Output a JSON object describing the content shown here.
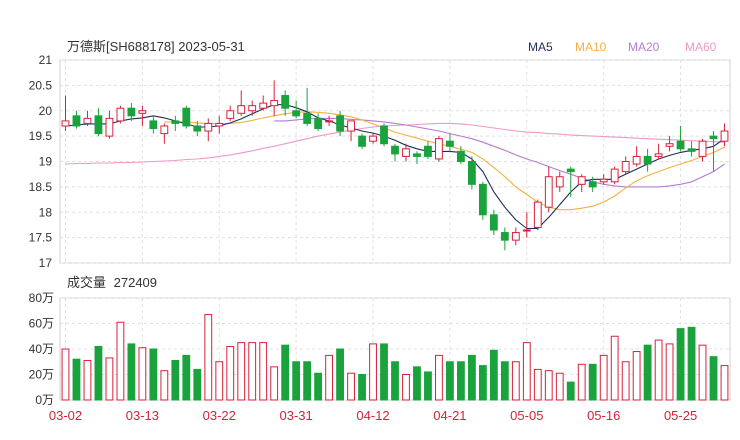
{
  "header": {
    "title": "万德斯[SH688178] 2023-05-31"
  },
  "legend": [
    {
      "label": "MA5",
      "color": "#1f2d5a"
    },
    {
      "label": "MA10",
      "color": "#f5b042"
    },
    {
      "label": "MA20",
      "color": "#b57cd6"
    },
    {
      "label": "MA60",
      "color": "#f098c8"
    }
  ],
  "colors": {
    "up": "#d8213a",
    "down": "#1aa33c"
  },
  "volume_title": {
    "label": "成交量",
    "value": "272409"
  },
  "chart_data": [
    {
      "type": "candlestick",
      "price_axis": {
        "ylim": [
          17,
          21
        ],
        "ticks": [
          "21",
          "20.5",
          "20",
          "19.5",
          "19",
          "18.5",
          "18",
          "17.5",
          "17"
        ]
      },
      "dates": [
        "03-02",
        "03-03",
        "03-06",
        "03-07",
        "03-08",
        "03-09",
        "03-10",
        "03-13",
        "03-14",
        "03-15",
        "03-16",
        "03-17",
        "03-20",
        "03-21",
        "03-22",
        "03-23",
        "03-24",
        "03-27",
        "03-28",
        "03-29",
        "03-30",
        "03-31",
        "04-03",
        "04-04",
        "04-06",
        "04-07",
        "04-10",
        "04-11",
        "04-12",
        "04-13",
        "04-14",
        "04-17",
        "04-18",
        "04-19",
        "04-20",
        "04-21",
        "04-24",
        "04-25",
        "04-26",
        "04-27",
        "04-28",
        "05-04",
        "05-05",
        "05-08",
        "05-09",
        "05-10",
        "05-11",
        "05-12",
        "05-15",
        "05-16",
        "05-17",
        "05-18",
        "05-19",
        "05-22",
        "05-23",
        "05-24",
        "05-25",
        "05-26",
        "05-29",
        "05-30",
        "05-31"
      ],
      "x_tick_labels": [
        "03-02",
        "03-13",
        "03-22",
        "03-31",
        "04-12",
        "04-21",
        "05-05",
        "05-16",
        "05-25"
      ],
      "ohlc": [
        [
          19.7,
          19.8,
          19.6,
          20.3
        ],
        [
          19.9,
          19.7,
          19.65,
          20.0
        ],
        [
          19.75,
          19.85,
          19.7,
          20.0
        ],
        [
          19.9,
          19.55,
          19.5,
          20.05
        ],
        [
          19.5,
          19.85,
          19.45,
          20.0
        ],
        [
          19.8,
          20.05,
          19.75,
          20.1
        ],
        [
          20.05,
          19.9,
          19.8,
          20.15
        ],
        [
          19.95,
          20.0,
          19.7,
          20.1
        ],
        [
          19.8,
          19.65,
          19.55,
          19.9
        ],
        [
          19.55,
          19.7,
          19.35,
          19.75
        ],
        [
          19.8,
          19.75,
          19.6,
          19.9
        ],
        [
          20.05,
          19.7,
          19.65,
          20.1
        ],
        [
          19.7,
          19.6,
          19.5,
          19.8
        ],
        [
          19.6,
          19.75,
          19.4,
          19.85
        ],
        [
          19.7,
          19.75,
          19.55,
          19.9
        ],
        [
          19.85,
          20.0,
          19.8,
          20.1
        ],
        [
          19.95,
          20.1,
          19.9,
          20.4
        ],
        [
          20.0,
          20.1,
          19.9,
          20.2
        ],
        [
          20.05,
          20.15,
          20.0,
          20.3
        ],
        [
          20.1,
          20.2,
          19.9,
          20.6
        ],
        [
          20.3,
          20.05,
          19.9,
          20.4
        ],
        [
          20.0,
          19.9,
          19.85,
          20.2
        ],
        [
          19.95,
          19.75,
          19.7,
          20.45
        ],
        [
          19.85,
          19.65,
          19.6,
          19.95
        ],
        [
          19.8,
          19.8,
          19.7,
          19.9
        ],
        [
          19.9,
          19.6,
          19.5,
          20.0
        ],
        [
          19.6,
          19.8,
          19.4,
          19.8
        ],
        [
          19.5,
          19.3,
          19.25,
          19.55
        ],
        [
          19.4,
          19.5,
          19.35,
          19.55
        ],
        [
          19.7,
          19.35,
          19.3,
          19.75
        ],
        [
          19.3,
          19.15,
          19.0,
          19.35
        ],
        [
          19.1,
          19.25,
          19.0,
          19.35
        ],
        [
          19.15,
          19.1,
          18.95,
          19.2
        ],
        [
          19.3,
          19.1,
          19.05,
          19.4
        ],
        [
          19.05,
          19.45,
          19.0,
          19.5
        ],
        [
          19.4,
          19.3,
          19.2,
          19.55
        ],
        [
          19.2,
          19.0,
          18.95,
          19.3
        ],
        [
          19.0,
          18.55,
          18.45,
          19.1
        ],
        [
          18.55,
          17.95,
          17.85,
          18.6
        ],
        [
          17.95,
          17.65,
          17.55,
          18.05
        ],
        [
          17.6,
          17.45,
          17.25,
          17.7
        ],
        [
          17.45,
          17.6,
          17.35,
          17.7
        ],
        [
          17.65,
          17.65,
          17.5,
          18.0
        ],
        [
          17.7,
          18.2,
          17.65,
          18.25
        ],
        [
          18.1,
          18.7,
          18.0,
          18.9
        ],
        [
          18.5,
          18.7,
          18.4,
          18.8
        ],
        [
          18.85,
          18.8,
          18.3,
          18.9
        ],
        [
          18.55,
          18.7,
          18.4,
          18.75
        ],
        [
          18.6,
          18.5,
          18.4,
          18.7
        ],
        [
          18.6,
          18.65,
          18.55,
          18.75
        ],
        [
          18.6,
          18.85,
          18.55,
          18.9
        ],
        [
          18.8,
          19.0,
          18.75,
          19.1
        ],
        [
          18.95,
          19.1,
          18.9,
          19.3
        ],
        [
          19.1,
          18.95,
          18.8,
          19.25
        ],
        [
          19.1,
          19.15,
          19.05,
          19.35
        ],
        [
          19.3,
          19.35,
          19.2,
          19.5
        ],
        [
          19.4,
          19.25,
          19.2,
          19.7
        ],
        [
          19.25,
          19.2,
          19.1,
          19.4
        ],
        [
          19.1,
          19.4,
          19.0,
          19.45
        ],
        [
          19.5,
          19.45,
          18.8,
          19.6
        ],
        [
          19.4,
          19.6,
          19.3,
          19.75
        ]
      ],
      "ma5": [
        19.7,
        19.72,
        19.74,
        19.74,
        19.74,
        19.8,
        19.84,
        19.86,
        19.9,
        19.86,
        19.8,
        19.74,
        19.68,
        19.68,
        19.7,
        19.76,
        19.84,
        19.94,
        20.04,
        20.12,
        20.12,
        20.06,
        19.98,
        19.86,
        19.8,
        19.72,
        19.66,
        19.6,
        19.56,
        19.5,
        19.42,
        19.32,
        19.25,
        19.2,
        19.2,
        19.2,
        19.18,
        19.05,
        18.8,
        18.4,
        18.1,
        17.85,
        17.68,
        17.68,
        17.9,
        18.15,
        18.4,
        18.6,
        18.65,
        18.65,
        18.65,
        18.75,
        18.85,
        18.95,
        19.05,
        19.12,
        19.18,
        19.22,
        19.25,
        19.3,
        19.45
      ],
      "ma10": [
        null,
        null,
        null,
        null,
        null,
        null,
        null,
        null,
        null,
        19.78,
        19.78,
        19.78,
        19.76,
        19.75,
        19.74,
        19.75,
        19.77,
        19.81,
        19.86,
        19.9,
        19.94,
        19.97,
        19.98,
        19.97,
        19.95,
        19.92,
        19.88,
        19.82,
        19.74,
        19.66,
        19.58,
        19.52,
        19.46,
        19.4,
        19.35,
        19.3,
        19.24,
        19.18,
        19.05,
        18.88,
        18.7,
        18.5,
        18.35,
        18.2,
        18.1,
        18.05,
        18.05,
        18.08,
        18.12,
        18.2,
        18.32,
        18.48,
        18.62,
        18.72,
        18.8,
        18.88,
        18.95,
        19.02,
        19.1,
        19.18,
        19.28
      ],
      "ma20": [
        null,
        null,
        null,
        null,
        null,
        null,
        null,
        null,
        null,
        null,
        null,
        null,
        null,
        null,
        null,
        null,
        null,
        null,
        null,
        19.8,
        19.8,
        19.82,
        19.84,
        19.85,
        19.85,
        19.85,
        19.83,
        19.82,
        19.8,
        19.78,
        19.75,
        19.72,
        19.68,
        19.64,
        19.6,
        19.55,
        19.5,
        19.45,
        19.38,
        19.3,
        19.22,
        19.13,
        19.05,
        18.98,
        18.9,
        18.82,
        18.75,
        18.67,
        18.6,
        18.55,
        18.52,
        18.5,
        18.5,
        18.5,
        18.5,
        18.52,
        18.55,
        18.6,
        18.7,
        18.8,
        18.95
      ],
      "ma60": [
        18.95,
        18.96,
        18.96,
        18.97,
        18.97,
        18.98,
        18.98,
        18.99,
        19.0,
        19.01,
        19.02,
        19.04,
        19.05,
        19.07,
        19.1,
        19.13,
        19.17,
        19.21,
        19.26,
        19.3,
        19.35,
        19.4,
        19.45,
        19.5,
        19.54,
        19.58,
        19.62,
        19.65,
        19.68,
        19.7,
        19.71,
        19.72,
        19.73,
        19.74,
        19.75,
        19.75,
        19.74,
        19.72,
        19.69,
        19.66,
        19.63,
        19.6,
        19.58,
        19.57,
        19.55,
        19.54,
        19.52,
        19.51,
        19.5,
        19.49,
        19.48,
        19.47,
        19.46,
        19.45,
        19.44,
        19.43,
        19.42,
        19.41,
        19.4,
        19.39,
        19.38
      ]
    },
    {
      "type": "bar",
      "title": "成交量",
      "unit": "万",
      "y_axis": {
        "ylim": [
          0,
          80
        ],
        "ticks": [
          "80万",
          "60万",
          "40万",
          "20万",
          "0万"
        ]
      },
      "values": [
        40,
        32,
        31,
        42,
        33,
        61,
        44,
        41,
        40,
        23,
        31,
        35,
        24,
        67,
        30,
        42,
        45,
        45,
        45,
        26,
        43,
        30,
        30,
        21,
        35,
        40,
        21,
        20,
        44,
        44,
        30,
        20,
        26,
        22,
        35,
        30,
        30,
        35,
        27,
        39,
        30,
        30,
        45,
        24,
        23,
        21,
        14,
        28,
        28,
        35,
        50,
        30,
        38,
        43,
        47,
        44,
        56,
        57,
        43,
        34,
        27
      ]
    }
  ]
}
